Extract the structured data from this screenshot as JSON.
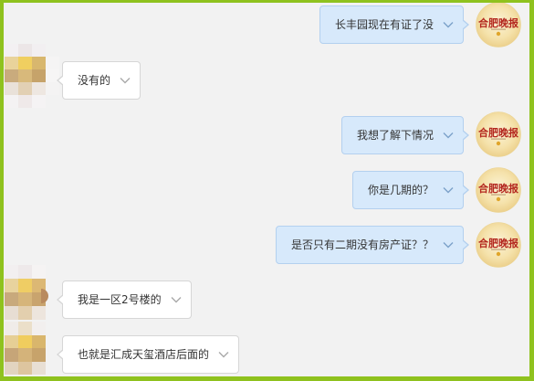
{
  "colors": {
    "frame_border": "#8fc21e",
    "background": "#f2f2f2",
    "sent_bubble_bg": "#d7e9fb",
    "sent_bubble_border": "#b3d0ef",
    "received_bubble_bg": "#ffffff",
    "received_bubble_border": "#d6d6d6",
    "text": "#333333"
  },
  "avatar_logo": {
    "text": "合肥晚报",
    "lettering_color": "#b3261e"
  },
  "messages": [
    {
      "outgoing": true,
      "text": "长丰园现在有证了没",
      "icon": "chevron-down-icon"
    },
    {
      "outgoing": false,
      "text": "没有的",
      "icon": "chevron-down-icon"
    },
    {
      "outgoing": true,
      "text": "我想了解下情况",
      "icon": "chevron-down-icon"
    },
    {
      "outgoing": true,
      "text": "你是几期的？",
      "icon": "chevron-down-icon"
    },
    {
      "outgoing": true,
      "text": "是否只有二期没有房产证？？",
      "icon": "chevron-down-icon"
    },
    {
      "outgoing": false,
      "text": "我是一区2号楼的",
      "icon": "chevron-down-icon"
    },
    {
      "outgoing": false,
      "text": "也就是汇成天玺酒店后面的",
      "icon": "chevron-down-icon"
    }
  ],
  "received_avatars": [
    {
      "pixels": [
        [
          "#f3f0f2",
          "#ece6e7",
          "#f2eff1",
          "#f2f2f2"
        ],
        [
          "#e9d39b",
          "#f0cf60",
          "#d8b76e",
          "#f5f4f4"
        ],
        [
          "#c9ab7d",
          "#d8b97b",
          "#c6a36a",
          "#f6f5f5"
        ],
        [
          "#e9e1d9",
          "#e2d0b4",
          "#eee7e1",
          "#f4f3f3"
        ],
        [
          "#f4f2f3",
          "#efe9e9",
          "#f5f3f4",
          "#f2f2f2"
        ]
      ]
    },
    {
      "pixels": [
        [
          "#f2eff0",
          "#eee9ea",
          "#f5f3f3"
        ],
        [
          "#e8d39e",
          "#efcd64",
          "#dcb874"
        ],
        [
          "#c8a97c",
          "#d6b57a",
          "#c9a46e"
        ],
        [
          "#e7ddd3",
          "#e3cfae",
          "#ede5dd"
        ]
      ]
    },
    {
      "pixels": [
        [
          "#f0ece9",
          "#ebdfc9",
          "#f2efee"
        ],
        [
          "#e6cf95",
          "#f0cd5e",
          "#d9b66c"
        ],
        [
          "#c6a578",
          "#d4b37a",
          "#c7a36b"
        ],
        [
          "#e2d4c0",
          "#ddc59f",
          "#e8dfd4"
        ]
      ]
    }
  ]
}
